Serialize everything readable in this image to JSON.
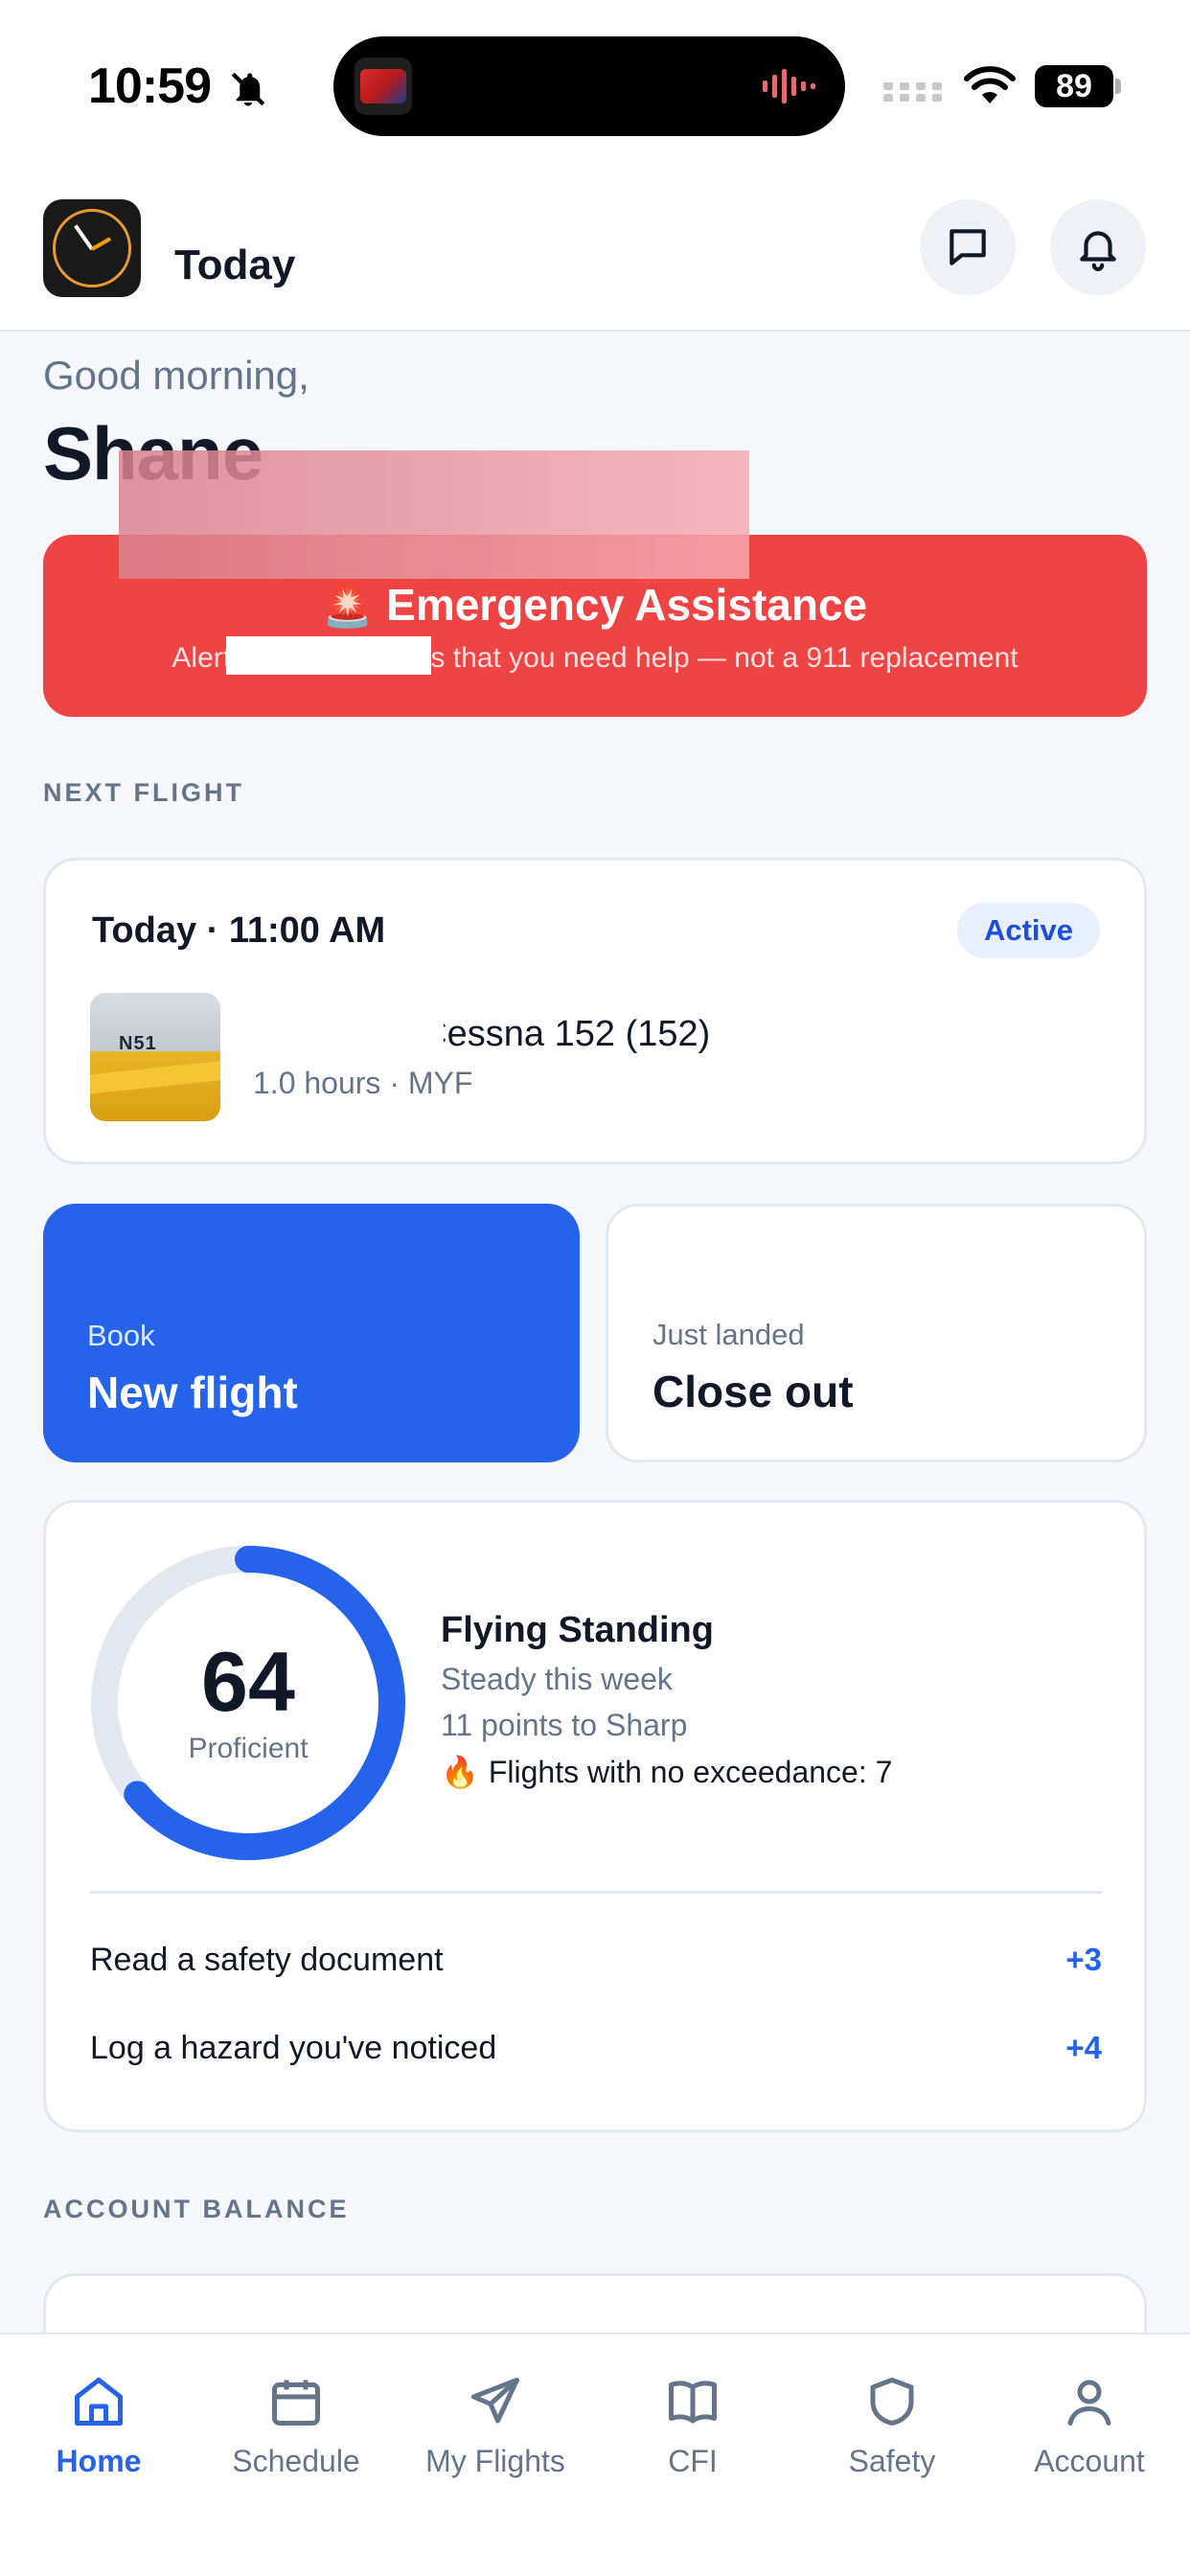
{
  "status_bar": {
    "time": "10:59",
    "battery": "89",
    "icons": [
      "bell-slash-icon",
      "signal-icon",
      "wifi-icon",
      "battery-icon"
    ]
  },
  "header": {
    "title": "Today",
    "icons": [
      "message-icon",
      "bell-icon"
    ]
  },
  "greeting": {
    "salutation": "Good morning,",
    "name": "Shane"
  },
  "emergency": {
    "title": "Emergency Assistance",
    "subtitle_start": "Alert ",
    "subtitle_end": "s that you need help — not a 911 replacement",
    "color": "#ef4444"
  },
  "next_flight": {
    "section_label": "NEXT FLIGHT",
    "when": "Today · 11:00 AM",
    "status": "Active",
    "aircraft": "- Cessna 152 (152)",
    "meta": "1.0 hours · MYF"
  },
  "actions": {
    "book_kicker": "Book",
    "book_title": "New flight",
    "close_kicker": "Just landed",
    "close_title": "Close out",
    "accent": "#2563eb"
  },
  "standing": {
    "score": "64",
    "score_value": 64,
    "score_max": 100,
    "level": "Proficient",
    "title": "Flying Standing",
    "trend": "Steady this week",
    "to_next": "11 points to Sharp",
    "streak": "Flights with no exceedance: 7",
    "tasks": [
      {
        "label": "Read a safety document",
        "points": "+3"
      },
      {
        "label": "Log a hazard you've noticed",
        "points": "+4"
      }
    ]
  },
  "balance": {
    "section_label": "ACCOUNT BALANCE",
    "peek": "• • • • • •"
  },
  "tabs": [
    {
      "label": "Home",
      "icon": "home-icon",
      "active": true
    },
    {
      "label": "Schedule",
      "icon": "calendar-icon",
      "active": false
    },
    {
      "label": "My Flights",
      "icon": "send-icon",
      "active": false
    },
    {
      "label": "CFI",
      "icon": "book-icon",
      "active": false
    },
    {
      "label": "Safety",
      "icon": "shield-icon",
      "active": false
    },
    {
      "label": "Account",
      "icon": "user-icon",
      "active": false
    }
  ]
}
